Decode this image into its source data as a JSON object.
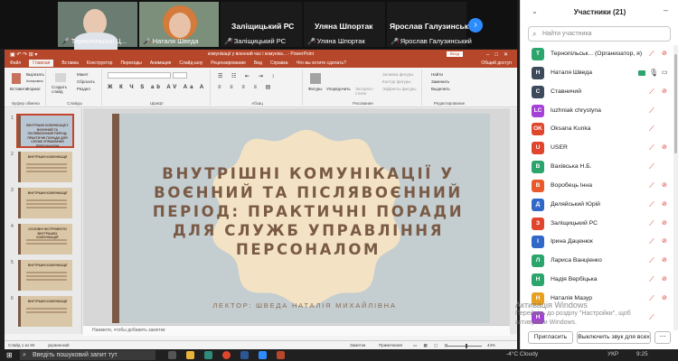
{
  "video_strip": {
    "tiles": [
      {
        "name": "Тернопільські Ц...",
        "muted": true
      },
      {
        "name": "Наталя Шведа",
        "muted": true
      },
      {
        "name": "Заліщицький РС",
        "label": "Заліщицький РС",
        "muted": true
      },
      {
        "name": "Уляна Шпортак",
        "label": "Уляна Шпортак",
        "muted": true
      },
      {
        "name": "Ярослав Галузинський",
        "label": "Ярослав Галузинський",
        "muted": true
      }
    ]
  },
  "powerpoint": {
    "title": "комунікації у воєнний час і комуніка...  -  PowerPoint",
    "login_label": "Вход",
    "tabs": [
      "Файл",
      "Главная",
      "Вставка",
      "Конструктор",
      "Переходы",
      "Анимация",
      "Слайд-шоу",
      "Рецензирование",
      "Вид",
      "Справка",
      "Что вы хотите сделать?"
    ],
    "active_tab": "Главная",
    "share_label": "Общий доступ",
    "ribbon": {
      "paste": "Вставить",
      "cut": "Вырезать",
      "copy": "Копировать",
      "format": "Формат",
      "new_slide": "Создать слайд",
      "layout": "Макет",
      "reset": "Сбросить",
      "section": "Раздел",
      "figures": "Фигуры",
      "arrange": "Упорядочить",
      "quick_styles": "Экспресс-стили",
      "fill": "Заливка фигуры",
      "outline": "Контур фигуры",
      "effects": "Эффекты фигуры",
      "find": "Найти",
      "replace": "Заменить",
      "select": "Выделить",
      "groups": [
        "Буфер обмена",
        "Слайды",
        "Шрифт",
        "Абзац",
        "Рисование",
        "Редактирование"
      ]
    },
    "slide": {
      "title": "ВНУТРІШНІ КОМУНІКАЦІЇ У ВОЄННИЙ ТА ПІСЛЯВОЄННИЙ ПЕРІОД: ПРАКТИЧНІ ПОРАДИ ДЛЯ СЛУЖБ УПРАВЛІННЯ ПЕРСОНАЛОМ",
      "lector": "ЛЕКТОР: ШВЕДА НАТАЛІЯ МИХАЙЛІВНА"
    },
    "thumbnails": [
      {
        "num": "1",
        "title": "ВНУТРІШНІ КОМУНІКАЦІЇ У ВОЄННИЙ ТА ПІСЛЯВОЄННИЙ ПЕРІОД: ПРАКТИЧНІ ПОРАДИ ДЛЯ СЛУЖБ УПРАВЛІННЯ ПЕРСОНАЛОМ"
      },
      {
        "num": "2",
        "title": "ВНУТРІШНІ КОМУНІКАЦІЇ"
      },
      {
        "num": "3",
        "title": "ВНУТРІШНІ КОМУНІКАЦІЇ"
      },
      {
        "num": "4",
        "title": "ОСНОВНІ ІНСТРУМЕНТИ ВНУТРІШНІХ КОМУНІКАЦІЙ"
      },
      {
        "num": "5",
        "title": "ВНУТРІШНІ КОМУНІКАЦІЇ"
      },
      {
        "num": "6",
        "title": "ВНУТРІШНІ КОМУНІКАЦІЇ"
      }
    ],
    "notes_placeholder": "Нажмите, чтобы добавить заметки",
    "status": {
      "slide_counter": "Слайд 1 из 50",
      "language": "украинский",
      "notes": "Заметки",
      "comments": "Примечания",
      "zoom": "44%"
    }
  },
  "participants": {
    "header": "Участники (21)",
    "search_placeholder": "Найти участника",
    "list": [
      {
        "initial": "T",
        "color": "#2ba56b",
        "name": "Тернопільськ... (Организатор, я)",
        "video": "off"
      },
      {
        "initial": "Н",
        "color": "#3d4a5c",
        "name": "Наталя Шведа",
        "video": "on",
        "share": true
      },
      {
        "initial": "С",
        "color": "#3d4a5c",
        "name": "Ставничий",
        "video": "off"
      },
      {
        "initial": "LC",
        "color": "#a541d6",
        "name": "luzhniak chrystyna",
        "video": "none"
      },
      {
        "initial": "OK",
        "color": "#e0462d",
        "name": "Oksana Kunka",
        "video": "none"
      },
      {
        "initial": "U",
        "color": "#e0462d",
        "name": "USER",
        "video": "off"
      },
      {
        "initial": "В",
        "color": "#2ba56b",
        "name": "Вахівська Н.Б.",
        "video": "none"
      },
      {
        "initial": "В",
        "color": "#e85a2b",
        "name": "Воробець Інна",
        "video": "off"
      },
      {
        "initial": "Д",
        "color": "#3168c8",
        "name": "Деляйський Юрій",
        "video": "off"
      },
      {
        "initial": "З",
        "color": "#e0462d",
        "name": "Заліщицький РС",
        "video": "off"
      },
      {
        "initial": "І",
        "color": "#3168c8",
        "name": "Ірина Даценюк",
        "video": "off"
      },
      {
        "initial": "Л",
        "color": "#2ba56b",
        "name": "Лариса Ванціенко",
        "video": "off"
      },
      {
        "initial": "Н",
        "color": "#2ba56b",
        "name": "Надія Вербіцька",
        "video": "off"
      },
      {
        "initial": "Н",
        "color": "#e8a020",
        "name": "Наталія Мазур",
        "video": "off"
      },
      {
        "initial": "Н",
        "color": "#a541d6",
        "name": "",
        "video": "none"
      }
    ],
    "invite_button": "Пригласить",
    "mute_all_button": "Выключить звук для всех"
  },
  "watermark": {
    "line1": "Активація Windows",
    "line2": "Перейдіть до розділу \"Настройки\", щоб",
    "line3": "активувати Windows."
  },
  "taskbar": {
    "search_placeholder": "Введіть пошуковий запит тут",
    "weather": "-4°C  Cloudy",
    "lang": "УКР",
    "time": "9:25"
  },
  "colors": {
    "ppt_accent": "#b7472a",
    "slide_bg": "#c4cdd0",
    "slide_text": "#7a5a45",
    "zoom_blue": "#2d8cff"
  }
}
